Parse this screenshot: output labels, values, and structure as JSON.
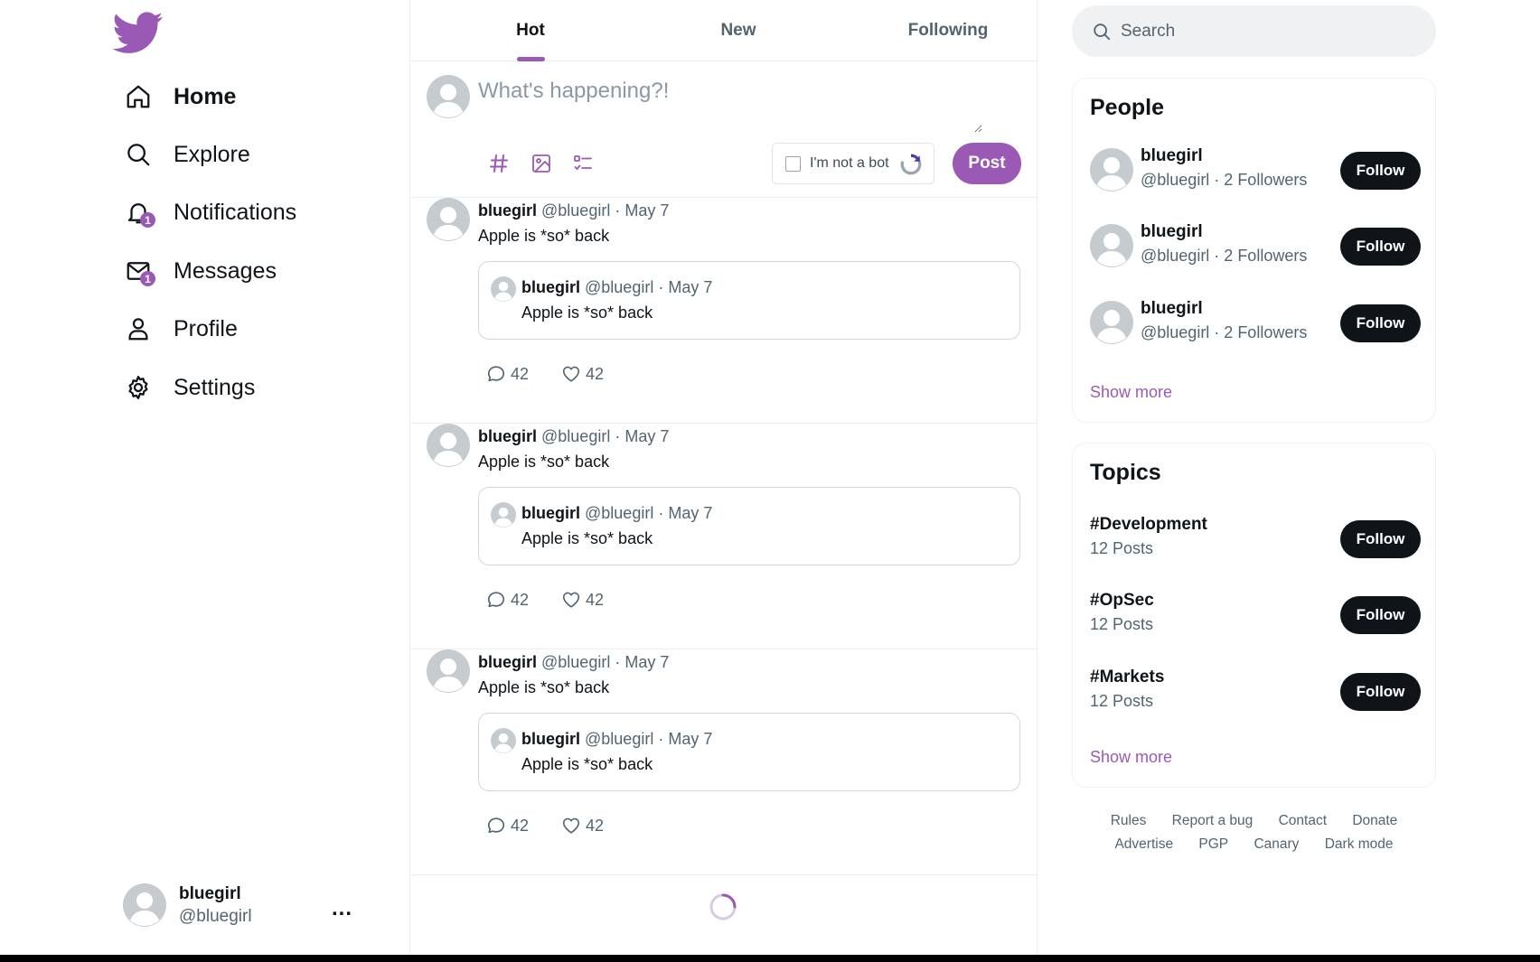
{
  "brand": {
    "accent": "#9b59b6",
    "logo_icon": "bird-logo-icon"
  },
  "nav": [
    {
      "label": "Home",
      "icon": "home-icon",
      "active": true
    },
    {
      "label": "Explore",
      "icon": "search-icon"
    },
    {
      "label": "Notifications",
      "icon": "bell-icon",
      "badge": "1"
    },
    {
      "label": "Messages",
      "icon": "mail-icon",
      "badge": "1"
    },
    {
      "label": "Profile",
      "icon": "user-icon"
    },
    {
      "label": "Settings",
      "icon": "gear-icon"
    }
  ],
  "account": {
    "name": "bluegirl",
    "handle": "@bluegirl",
    "more": "..."
  },
  "tabs": [
    {
      "label": "Hot",
      "active": true
    },
    {
      "label": "New"
    },
    {
      "label": "Following"
    }
  ],
  "composer": {
    "placeholder": "What's happening?!",
    "captcha_label": "I'm not a bot",
    "post_label": "Post"
  },
  "tweets": [
    {
      "name": "bluegirl",
      "meta": " @bluegirl · May 7",
      "text": "Apple is *so* back",
      "quote": {
        "name": "bluegirl",
        "meta": " @bluegirl · May 7",
        "text": "Apple is *so* back"
      },
      "replies": "42",
      "likes": "42"
    },
    {
      "name": "bluegirl",
      "meta": " @bluegirl · May 7",
      "text": "Apple is *so* back",
      "quote": {
        "name": "bluegirl",
        "meta": " @bluegirl · May 7",
        "text": "Apple is *so* back"
      },
      "replies": "42",
      "likes": "42"
    },
    {
      "name": "bluegirl",
      "meta": " @bluegirl · May 7",
      "text": "Apple is *so* back",
      "quote": {
        "name": "bluegirl",
        "meta": " @bluegirl · May 7",
        "text": "Apple is *so* back"
      },
      "replies": "42",
      "likes": "42"
    }
  ],
  "search": {
    "placeholder": "Search"
  },
  "people": {
    "title": "People",
    "items": [
      {
        "name": "bluegirl",
        "sub": "@bluegirl · 2 Followers",
        "button": "Follow"
      },
      {
        "name": "bluegirl",
        "sub": "@bluegirl · 2 Followers",
        "button": "Follow"
      },
      {
        "name": "bluegirl",
        "sub": "@bluegirl · 2 Followers",
        "button": "Follow"
      }
    ],
    "show_more": "Show more"
  },
  "topics": {
    "title": "Topics",
    "items": [
      {
        "name": "#Development",
        "sub": "12 Posts",
        "button": "Follow"
      },
      {
        "name": "#OpSec",
        "sub": "12 Posts",
        "button": "Follow"
      },
      {
        "name": "#Markets",
        "sub": "12 Posts",
        "button": "Follow"
      }
    ],
    "show_more": "Show more"
  },
  "footer": {
    "row1": [
      "Rules",
      "Report a bug",
      "Contact",
      "Donate"
    ],
    "row2": [
      "Advertise",
      "PGP",
      "Canary",
      "Dark mode"
    ]
  }
}
